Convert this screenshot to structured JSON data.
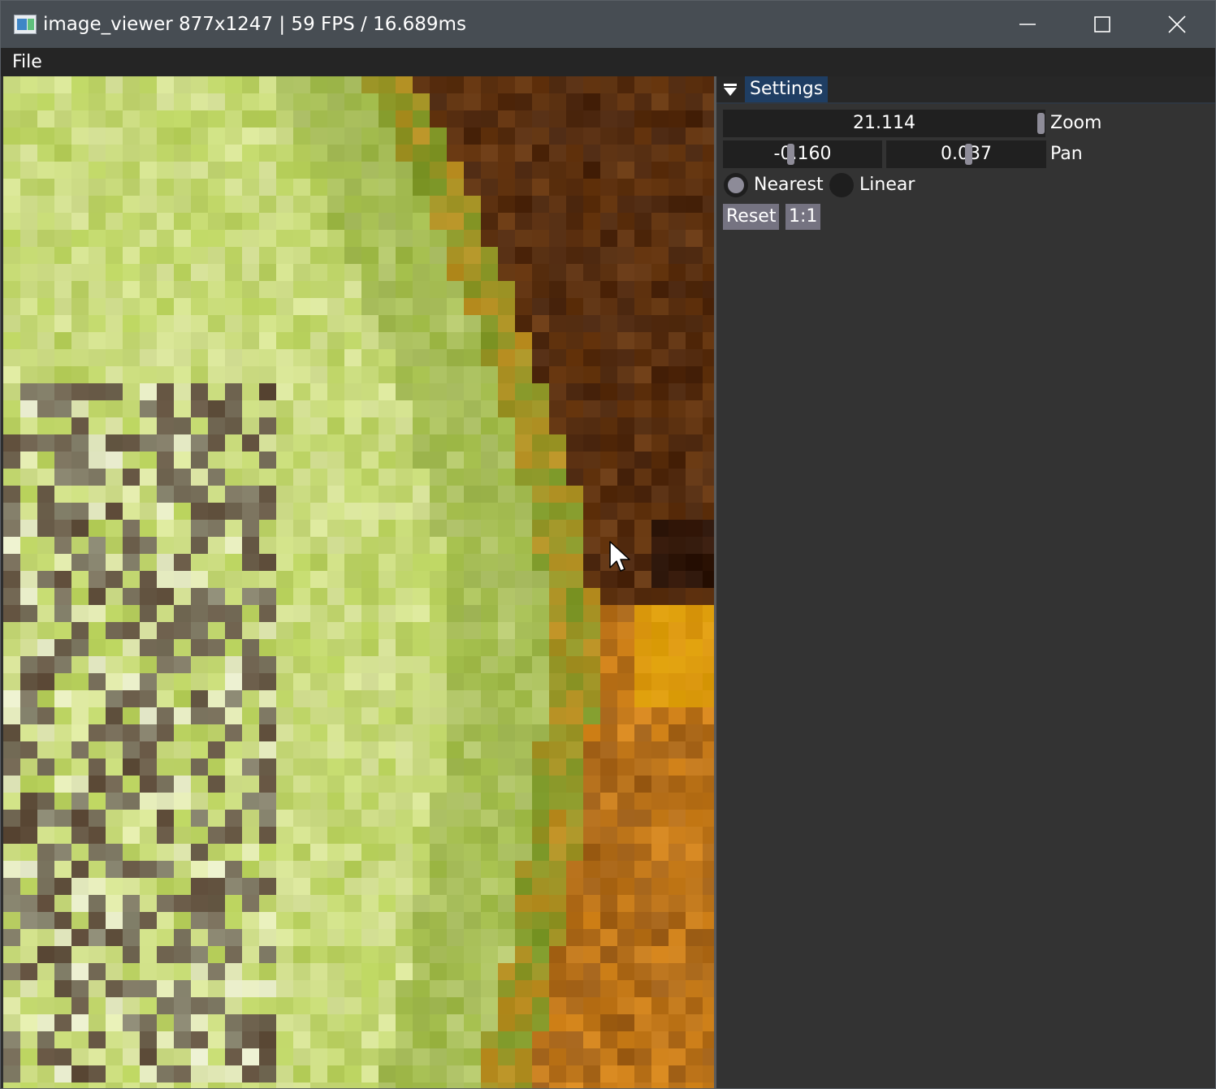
{
  "window": {
    "title": "image_viewer 877x1247 | 59 FPS / 16.689ms",
    "icon": "app-image-icon",
    "controls": [
      "minimize-icon",
      "maximize-icon",
      "close-icon"
    ]
  },
  "menu": {
    "items": [
      {
        "label": "File"
      }
    ]
  },
  "viewer": {
    "content": "zoomed-pixelated-image",
    "colors": {
      "green_light": "#dfe8a6",
      "green": "#b7d05a",
      "green_dark": "#7d9a2a",
      "gray_speckle": "#8c8a74",
      "orange": "#d9891e",
      "brown": "#6b3a12",
      "dark_brown": "#3a1c0c"
    }
  },
  "settings": {
    "header": "Settings",
    "zoom": {
      "value": "21.114",
      "label": "Zoom"
    },
    "pan": {
      "x": "-0.160",
      "y": "0.037",
      "label": "Pan"
    },
    "filter": {
      "options": [
        {
          "label": "Nearest",
          "selected": true
        },
        {
          "label": "Linear",
          "selected": false
        }
      ]
    },
    "buttons": {
      "reset": "Reset",
      "one_to_one": "1:1"
    }
  },
  "colors": {
    "titlebar": "#474d53",
    "menubar": "#252525",
    "panel": "#333333",
    "header_tab": "#1f3e63",
    "field": "#202020",
    "button": "#757381",
    "grab": "#8e8c98"
  }
}
